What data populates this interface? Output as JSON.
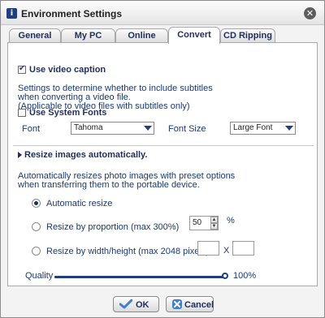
{
  "window": {
    "title": "Environment Settings"
  },
  "tabs": [
    "General",
    "My PC",
    "Online",
    "Convert",
    "CD Ripping"
  ],
  "video_caption": {
    "label": "Use video caption",
    "desc_line1": "Settings to determine whether to include subtitles",
    "desc_line2": "when converting a video file.",
    "desc_line3": "(Applicable to video files with subtitles only)",
    "system_fonts_label": "Use System Fonts",
    "font_label": "Font",
    "font_value": "Tahoma",
    "font_size_label": "Font Size",
    "font_size_value": "Large Font"
  },
  "resize": {
    "heading": "Resize images automatically.",
    "desc_line1": "Automatically resizes photo images with preset options",
    "desc_line2": "when transferring them to the portable device.",
    "option_auto": "Automatic resize",
    "option_proportion": "Resize by proportion (max 300%)",
    "proportion_value": "50",
    "percent_sign": "%",
    "option_dimensions": "Resize by width/height (max 2048 pixels)",
    "x_label": "X",
    "width_value": "",
    "height_value": ""
  },
  "quality": {
    "label": "Quality",
    "value_text": "100%",
    "level": 1.0
  },
  "buttons": {
    "ok": "OK",
    "cancel": "Cancel"
  },
  "icons": [
    "info-icon",
    "close-icon",
    "checkmark-icon",
    "cancel-x-icon",
    "expand-triangle-icon",
    "dropdown-arrow-icon"
  ]
}
